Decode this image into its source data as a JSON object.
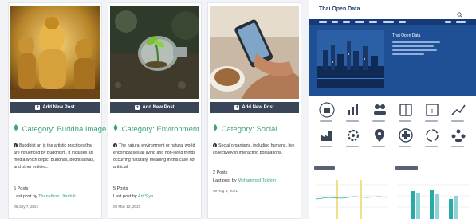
{
  "cards": [
    {
      "add_label": "Add New Post",
      "category_prefix": "Category:",
      "category_name": "Buddha Image",
      "description": "Buddhist art is the artistic practices that are influenced by Buddhism. It includes art media which depict Buddhas, bodhisattvas, and other entities...",
      "posts": "5 Posts",
      "last_post_prefix": "Last post by",
      "last_post_author": "Thanathon Utanhiti",
      "date": "09 July 7, 2021"
    },
    {
      "add_label": "Add New Post",
      "category_prefix": "Category:",
      "category_name": "Environment",
      "description": "The natural environment or natural world encompasses all living and non-living things occurring naturally, meaning in this case not artificial.",
      "posts": "5 Posts",
      "last_post_prefix": "Last post by",
      "last_post_author": "Art Siya",
      "date": "09 May 12, 2021"
    },
    {
      "add_label": "Add New Post",
      "category_prefix": "Category:",
      "category_name": "Social",
      "description": "Social organisms, including humans, live collectively in interacting populations.",
      "posts": "2 Posts",
      "last_post_prefix": "Last post by",
      "last_post_author": "Mohammad Takhim",
      "date": "09 Aug 3, 2021"
    }
  ],
  "site": {
    "logo": "Thai Open Data",
    "hero_title": "Thai Open Data"
  },
  "colors": {
    "accent_green": "#3aa57a",
    "button_dark": "#3a4558",
    "site_blue": "#163a78"
  }
}
